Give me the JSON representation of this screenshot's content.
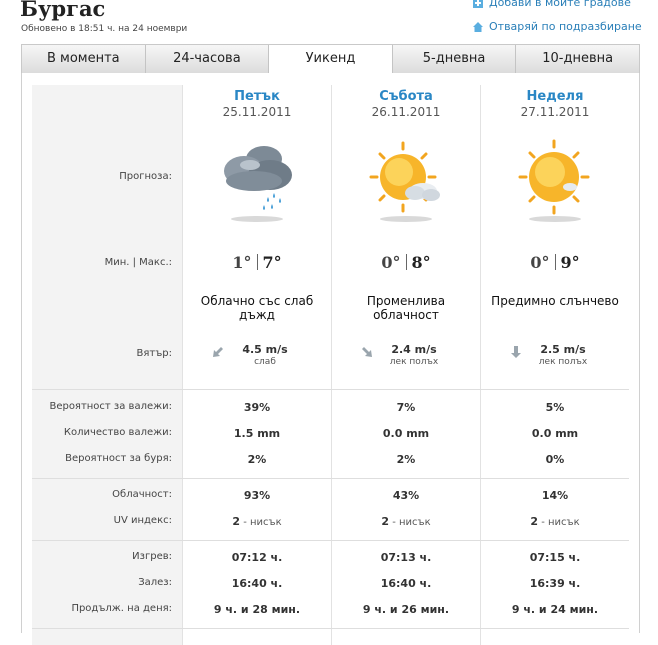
{
  "header": {
    "city": "Бургас",
    "updated": "Обновено в 18:51 ч. на 24 ноември",
    "add_link": "Добави в моите градове",
    "default_link": "Отваряй по подразбиране"
  },
  "tabs": [
    "В момента",
    "24-часова",
    "Уикенд",
    "5-дневна",
    "10-дневна"
  ],
  "labels": {
    "forecast": "Прогноза:",
    "minmax": "Мин. | Макс.:",
    "wind": "Вятър:",
    "precip_prob": "Вероятност за валежи:",
    "precip_amount": "Количество валежи:",
    "storm_prob": "Вероятност за буря:",
    "cloudiness": "Облачност:",
    "uv": "UV индекс:",
    "sunrise": "Изгрев:",
    "sunset": "Залез:",
    "daylength": "Продълж. на деня:"
  },
  "days": [
    {
      "name": "Петък",
      "date": "25.11.2011",
      "icon": "cloud-rain-icon",
      "min": "1°",
      "max": "7°",
      "desc1": "Облачно със слаб",
      "desc2": "дъжд",
      "wind_speed": "4.5 m/s",
      "wind_name": "слаб",
      "wind_icon": "arrow-down-left-icon",
      "precip_prob": "39%",
      "precip_amount": "1.5 mm",
      "storm_prob": "2%",
      "cloudiness": "93%",
      "uv_value": "2",
      "uv_text": " - нисък",
      "sunrise": "07:12 ч.",
      "sunset": "16:40 ч.",
      "daylength": "9 ч. и 28 мин."
    },
    {
      "name": "Събота",
      "date": "26.11.2011",
      "icon": "sun-cloud-icon",
      "min": "0°",
      "max": "8°",
      "desc1": "Променлива",
      "desc2": "облачност",
      "wind_speed": "2.4 m/s",
      "wind_name": "лек полъх",
      "wind_icon": "arrow-down-right-icon",
      "precip_prob": "7%",
      "precip_amount": "0.0 mm",
      "storm_prob": "2%",
      "cloudiness": "43%",
      "uv_value": "2",
      "uv_text": " - нисък",
      "sunrise": "07:13 ч.",
      "sunset": "16:40 ч.",
      "daylength": "9 ч. и 26 мин."
    },
    {
      "name": "Неделя",
      "date": "27.11.2011",
      "icon": "sun-icon",
      "min": "0°",
      "max": "9°",
      "desc1": "Предимно слънчево",
      "desc2": "",
      "wind_speed": "2.5 m/s",
      "wind_name": "лек полъх",
      "wind_icon": "arrow-down-icon",
      "precip_prob": "5%",
      "precip_amount": "0.0 mm",
      "storm_prob": "0%",
      "cloudiness": "14%",
      "uv_value": "2",
      "uv_text": " - нисък",
      "sunrise": "07:15 ч.",
      "sunset": "16:39 ч.",
      "daylength": "9 ч. и 24 мин."
    }
  ]
}
